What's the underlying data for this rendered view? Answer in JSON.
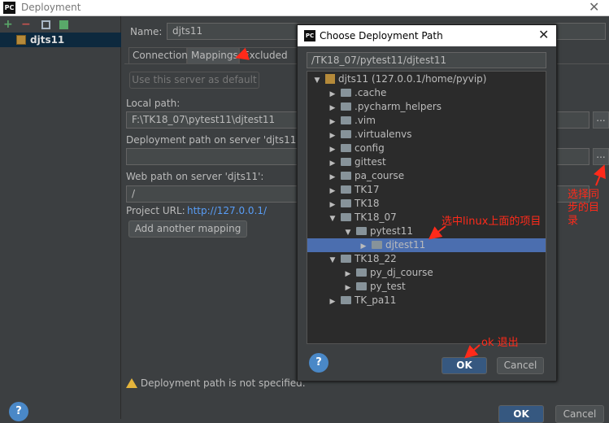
{
  "window": {
    "title": "Deployment",
    "app_icon": "PC"
  },
  "toolbar": {
    "add": "+",
    "remove": "−"
  },
  "sidebar": {
    "server_name": "djts11"
  },
  "form": {
    "name_label": "Name:",
    "name_value": "djts11",
    "tabs": [
      "Connection",
      "Mappings",
      "Excluded Pa"
    ],
    "use_default_label": "Use this server as default",
    "local_path_label": "Local path:",
    "local_path_value": "F:\\TK18_07\\pytest11\\djtest11",
    "deploy_path_label": "Deployment path on server 'djts11':",
    "deploy_path_value": "",
    "web_path_label": "Web path on server 'djts11':",
    "web_path_value": "/",
    "project_url_label": "Project URL:",
    "project_url_value": "http://127.0.0.1/",
    "add_mapping_label": "Add another mapping",
    "dots": "...",
    "warning": "Deployment path is not specified.",
    "ok_label": "OK",
    "cancel_label": "Cancel"
  },
  "dialog": {
    "title": "Choose Deployment Path",
    "app_icon": "PC",
    "path": "/TK18_07/pytest11/djtest11",
    "tree": [
      {
        "label": "djts11 (127.0.0.1/home/pyvip)",
        "indent": 0,
        "arrow": "down",
        "icon": "server",
        "selected": false
      },
      {
        "label": ".cache",
        "indent": 1,
        "arrow": "right",
        "icon": "folder",
        "selected": false
      },
      {
        "label": ".pycharm_helpers",
        "indent": 1,
        "arrow": "right",
        "icon": "folder",
        "selected": false
      },
      {
        "label": ".vim",
        "indent": 1,
        "arrow": "right",
        "icon": "folder",
        "selected": false
      },
      {
        "label": ".virtualenvs",
        "indent": 1,
        "arrow": "right",
        "icon": "folder",
        "selected": false
      },
      {
        "label": "config",
        "indent": 1,
        "arrow": "right",
        "icon": "folder",
        "selected": false
      },
      {
        "label": "gittest",
        "indent": 1,
        "arrow": "right",
        "icon": "folder",
        "selected": false
      },
      {
        "label": "pa_course",
        "indent": 1,
        "arrow": "right",
        "icon": "folder",
        "selected": false
      },
      {
        "label": "TK17",
        "indent": 1,
        "arrow": "right",
        "icon": "folder",
        "selected": false
      },
      {
        "label": "TK18",
        "indent": 1,
        "arrow": "right",
        "icon": "folder",
        "selected": false
      },
      {
        "label": "TK18_07",
        "indent": 1,
        "arrow": "down",
        "icon": "folder",
        "selected": false
      },
      {
        "label": "pytest11",
        "indent": 2,
        "arrow": "down",
        "icon": "folder",
        "selected": false
      },
      {
        "label": "djtest11",
        "indent": 3,
        "arrow": "right",
        "icon": "folder",
        "selected": true
      },
      {
        "label": "TK18_22",
        "indent": 1,
        "arrow": "down",
        "icon": "folder",
        "selected": false
      },
      {
        "label": "py_dj_course",
        "indent": 2,
        "arrow": "right",
        "icon": "folder",
        "selected": false
      },
      {
        "label": "py_test",
        "indent": 2,
        "arrow": "right",
        "icon": "folder",
        "selected": false
      },
      {
        "label": "TK_pa11",
        "indent": 1,
        "arrow": "right",
        "icon": "folder",
        "selected": false
      }
    ],
    "ok_label": "OK",
    "cancel_label": "Cancel"
  },
  "annotations": {
    "choose_sync_dir": "选择同步的目录",
    "select_linux_project": "选中linux上面的项目",
    "ok_exit": "ok 退出"
  },
  "colors": {
    "accent": "#4b6eaf",
    "annotation": "#ff2a1a",
    "link": "#589df6"
  }
}
